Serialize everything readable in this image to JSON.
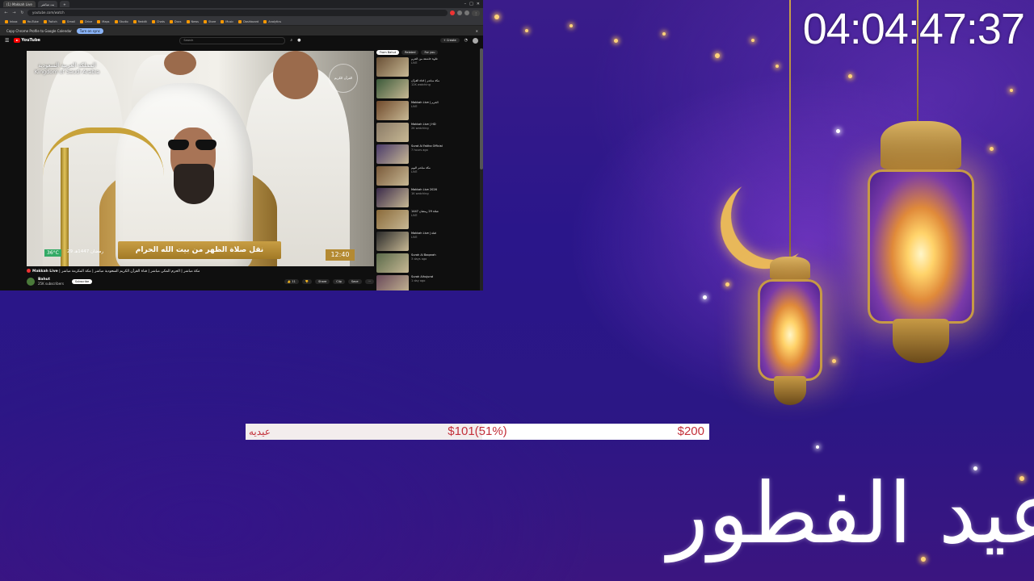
{
  "browser": {
    "tabs": [
      {
        "label": "(1) Makkah Live",
        "active": true
      },
      {
        "label": "ﺑﺚ ﻣﺒﺎﺷﺮ",
        "active": false
      },
      {
        "label": "",
        "active": false
      }
    ],
    "url": "youtube.com/watch",
    "bookmarks": [
      "Inbox",
      "YouTube",
      "Twitch",
      "Gmail",
      "Drive",
      "Maps",
      "Studio",
      "Reddit",
      "Chats",
      "Docs",
      "News",
      "Store",
      "Music",
      "Dashboard",
      "Analytics"
    ],
    "infobar": {
      "text": "Copy Chrome Profile to Google Calendar",
      "button": "Turn on sync"
    }
  },
  "youtube": {
    "logo": "YouTube",
    "search_placeholder": "Search",
    "create_label": "+ Create",
    "player": {
      "watermark_ar": "المملكة العربية السعودية",
      "watermark_en": "Kingdom of Saudi Arabia",
      "lower_third": "نقل صلاة الظهر من بيت الله الحرام",
      "time": "12:40",
      "temp": "36°C",
      "hijri_date": "29 رمضان 1447هـ",
      "channel_logo": "القرآن الكريم"
    },
    "video_title": "مكة مباشر | الحرم المكي مباشر | قناة القرآن الكريم السعودية مباشر | مكة المكرمة مباشر",
    "live_label": "Makkah Live",
    "channel": {
      "name": "Bahut",
      "subs": "25K subscribers",
      "subscribe": "Subscribe"
    },
    "actions": [
      "👍 11",
      "👎",
      "Share",
      "Clip",
      "Save",
      "⋯"
    ],
    "chips": [
      {
        "label": "From Bahut",
        "active": true
      },
      {
        "label": "Related",
        "active": false
      },
      {
        "label": "For you",
        "active": false
      }
    ],
    "recommendations": [
      {
        "title": "تلاوة خاشعة من الحرم",
        "meta": "LIVE"
      },
      {
        "title": "مكة مباشر | قناة القرآن",
        "meta": "12K watching"
      },
      {
        "title": "Makkah Live | الحرم",
        "meta": "LIVE"
      },
      {
        "title": "Makkah Live | HD",
        "meta": "2K watching"
      },
      {
        "title": "Surat Al Fatiha Official",
        "meta": "7 hours ago"
      },
      {
        "title": "مكة مباشر اليوم",
        "meta": "LIVE"
      },
      {
        "title": "Makkah Live 2026",
        "meta": "1K watching"
      },
      {
        "title": "صلاة 29 رمضان 1447",
        "meta": "LIVE"
      },
      {
        "title": "Makkah Live | قناة",
        "meta": "LIVE"
      },
      {
        "title": "Surah Al Baqarah",
        "meta": "3 days ago"
      },
      {
        "title": "Surah Alhujurat",
        "meta": "1 day ago"
      }
    ]
  },
  "overlay": {
    "clock": "04:04:47:37",
    "goal_name": "عيديه",
    "goal_current": "$101(51%)",
    "goal_target": "$200",
    "goal_progress": 0.51,
    "eid_text": "عيد الفطور"
  },
  "colors": {
    "accent": "#c3303a",
    "gold": "#d9b262",
    "bg": "#2a168a"
  }
}
